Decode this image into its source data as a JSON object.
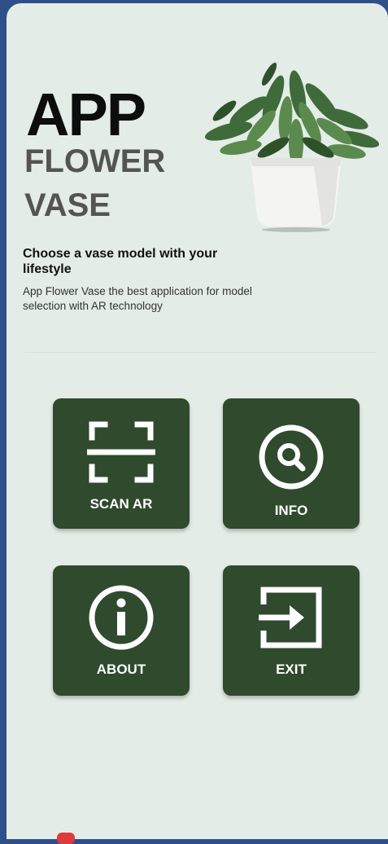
{
  "hero": {
    "app": "APP",
    "flower": "FLOWER",
    "vase": "VASE"
  },
  "intro": {
    "tagline": "Choose a vase model with your lifestyle",
    "description": "App Flower Vase the best application for model selection with AR technology"
  },
  "menu": {
    "scan_label": "SCAN AR",
    "info_label": "INFO",
    "about_label": "ABOUT",
    "exit_label": "EXIT"
  },
  "icons": {
    "scan": "scan-frame-icon",
    "info": "search-magnifier-icon",
    "about": "info-circle-icon",
    "exit": "exit-arrow-icon"
  },
  "colors": {
    "background": "#e4ece7",
    "tile": "#2f4a2d",
    "heading": "#0d0d0d",
    "subheading": "#545454"
  }
}
